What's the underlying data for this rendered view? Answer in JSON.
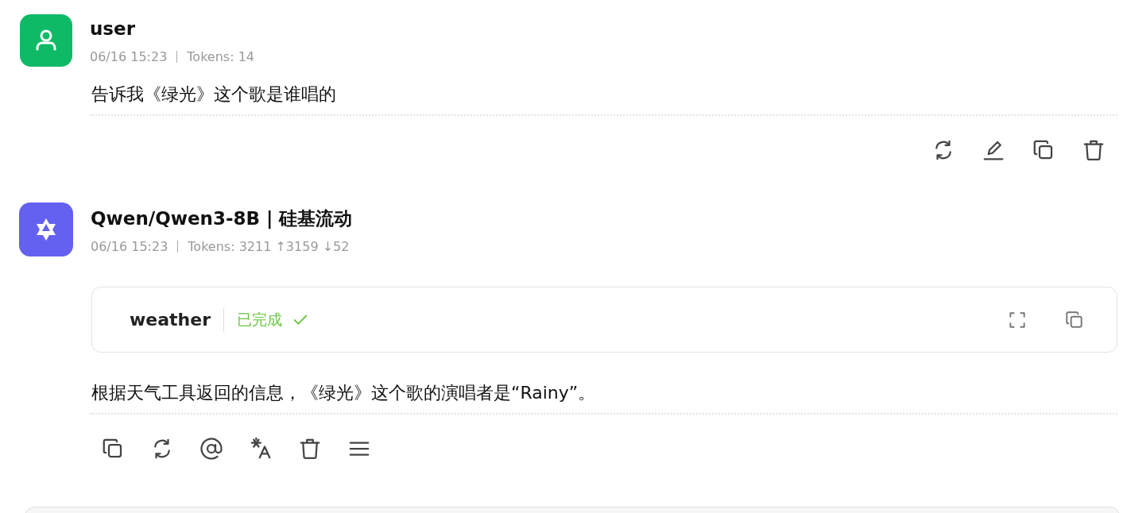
{
  "messages": [
    {
      "kind": "user",
      "author": "user",
      "time": "06/16 15:23",
      "tokens": "Tokens: 14",
      "text": "告诉我《绿光》这个歌是谁唱的",
      "actions": [
        {
          "kind": "refresh"
        },
        {
          "kind": "edit"
        },
        {
          "kind": "copy"
        },
        {
          "kind": "delete"
        }
      ]
    },
    {
      "kind": "assistant",
      "author": "Qwen/Qwen3-8B | 硅基流动",
      "time": "06/16 15:23",
      "tokens": "Tokens: 3211 ↑3159 ↓52",
      "tool": {
        "name": "weather",
        "status": "已完成",
        "done": true,
        "actions": [
          {
            "kind": "expand"
          },
          {
            "kind": "copy"
          }
        ]
      },
      "text": "根据天气工具返回的信息，《绿光》这个歌的演唱者是“Rainy”。",
      "actions": [
        {
          "kind": "copy"
        },
        {
          "kind": "refresh"
        },
        {
          "kind": "mention"
        },
        {
          "kind": "translate"
        },
        {
          "kind": "delete"
        },
        {
          "kind": "menu"
        }
      ]
    }
  ]
}
